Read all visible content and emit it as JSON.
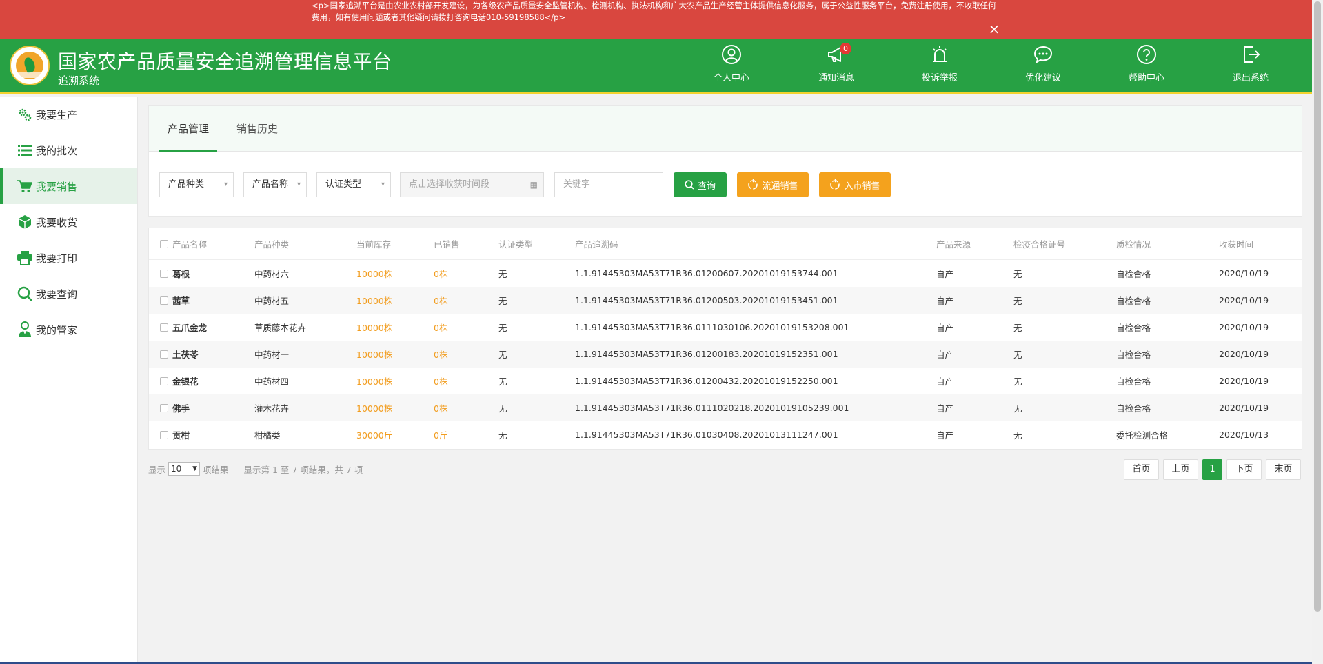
{
  "notice": {
    "text": "<p>国家追溯平台是由农业农村部开发建设，为各级农产品质量安全监管机构、检测机构、执法机构和广大农产品生产经营主体提供信息化服务，属于公益性服务平台，免费注册使用，不收取任何费用，如有使用问题或者其他疑问请拨打咨询电话010-59198588</p>",
    "close": "×"
  },
  "header": {
    "title": "国家农产品质量安全追溯管理信息平台",
    "subtitle": "追溯系统",
    "nav": [
      {
        "label": "个人中心",
        "icon": "user-icon"
      },
      {
        "label": "通知消息",
        "icon": "megaphone-icon",
        "badge": "0"
      },
      {
        "label": "投诉举报",
        "icon": "alarm-icon"
      },
      {
        "label": "优化建议",
        "icon": "chat-icon"
      },
      {
        "label": "帮助中心",
        "icon": "help-icon"
      },
      {
        "label": "退出系统",
        "icon": "logout-icon"
      }
    ]
  },
  "sidebar": {
    "items": [
      {
        "label": "我要生产",
        "icon": "gears-icon"
      },
      {
        "label": "我的批次",
        "icon": "list-icon"
      },
      {
        "label": "我要销售",
        "icon": "cart-icon",
        "active": true
      },
      {
        "label": "我要收货",
        "icon": "box-icon"
      },
      {
        "label": "我要打印",
        "icon": "printer-icon"
      },
      {
        "label": "我要查询",
        "icon": "search-icon"
      },
      {
        "label": "我的管家",
        "icon": "butler-icon"
      }
    ]
  },
  "tabs": [
    {
      "label": "产品管理",
      "active": true
    },
    {
      "label": "销售历史"
    }
  ],
  "filters": {
    "category": "产品种类",
    "name": "产品名称",
    "cert": "认证类型",
    "date_placeholder": "点击选择收获时间段",
    "keyword_placeholder": "关键字",
    "query": "查询",
    "circulation": "流通销售",
    "market": "入市销售"
  },
  "table": {
    "headers": [
      "产品名称",
      "产品种类",
      "当前库存",
      "已销售",
      "认证类型",
      "产品追溯码",
      "产品来源",
      "检疫合格证号",
      "质检情况",
      "收获时间"
    ],
    "rows": [
      [
        "葛根",
        "中药材六",
        "10000株",
        "0株",
        "无",
        "1.1.91445303MA53T71R36.01200607.20201019153744.001",
        "自产",
        "无",
        "自检合格",
        "2020/10/19"
      ],
      [
        "茜草",
        "中药材五",
        "10000株",
        "0株",
        "无",
        "1.1.91445303MA53T71R36.01200503.20201019153451.001",
        "自产",
        "无",
        "自检合格",
        "2020/10/19"
      ],
      [
        "五爪金龙",
        "草质藤本花卉",
        "10000株",
        "0株",
        "无",
        "1.1.91445303MA53T71R36.0111030106.20201019153208.001",
        "自产",
        "无",
        "自检合格",
        "2020/10/19"
      ],
      [
        "土茯苓",
        "中药材一",
        "10000株",
        "0株",
        "无",
        "1.1.91445303MA53T71R36.01200183.20201019152351.001",
        "自产",
        "无",
        "自检合格",
        "2020/10/19"
      ],
      [
        "金银花",
        "中药材四",
        "10000株",
        "0株",
        "无",
        "1.1.91445303MA53T71R36.01200432.20201019152250.001",
        "自产",
        "无",
        "自检合格",
        "2020/10/19"
      ],
      [
        "佛手",
        "灌木花卉",
        "10000株",
        "0株",
        "无",
        "1.1.91445303MA53T71R36.0111020218.20201019105239.001",
        "自产",
        "无",
        "自检合格",
        "2020/10/19"
      ],
      [
        "贡柑",
        "柑橘类",
        "30000斤",
        "0斤",
        "无",
        "1.1.91445303MA53T71R36.01030408.20201013111247.001",
        "自产",
        "无",
        "委托检测合格",
        "2020/10/13"
      ]
    ]
  },
  "pagination": {
    "show": "显示",
    "page_size": "10",
    "suffix": "项结果",
    "summary": "显示第 1 至 7 项结果，共 7 项",
    "first": "首页",
    "prev": "上页",
    "current": "1",
    "next": "下页",
    "last": "末页"
  },
  "colors": {
    "brand_green": "#27a144",
    "notice_red": "#d9473f",
    "accent_orange": "#f4a21d",
    "header_underline": "#f3d22e"
  }
}
